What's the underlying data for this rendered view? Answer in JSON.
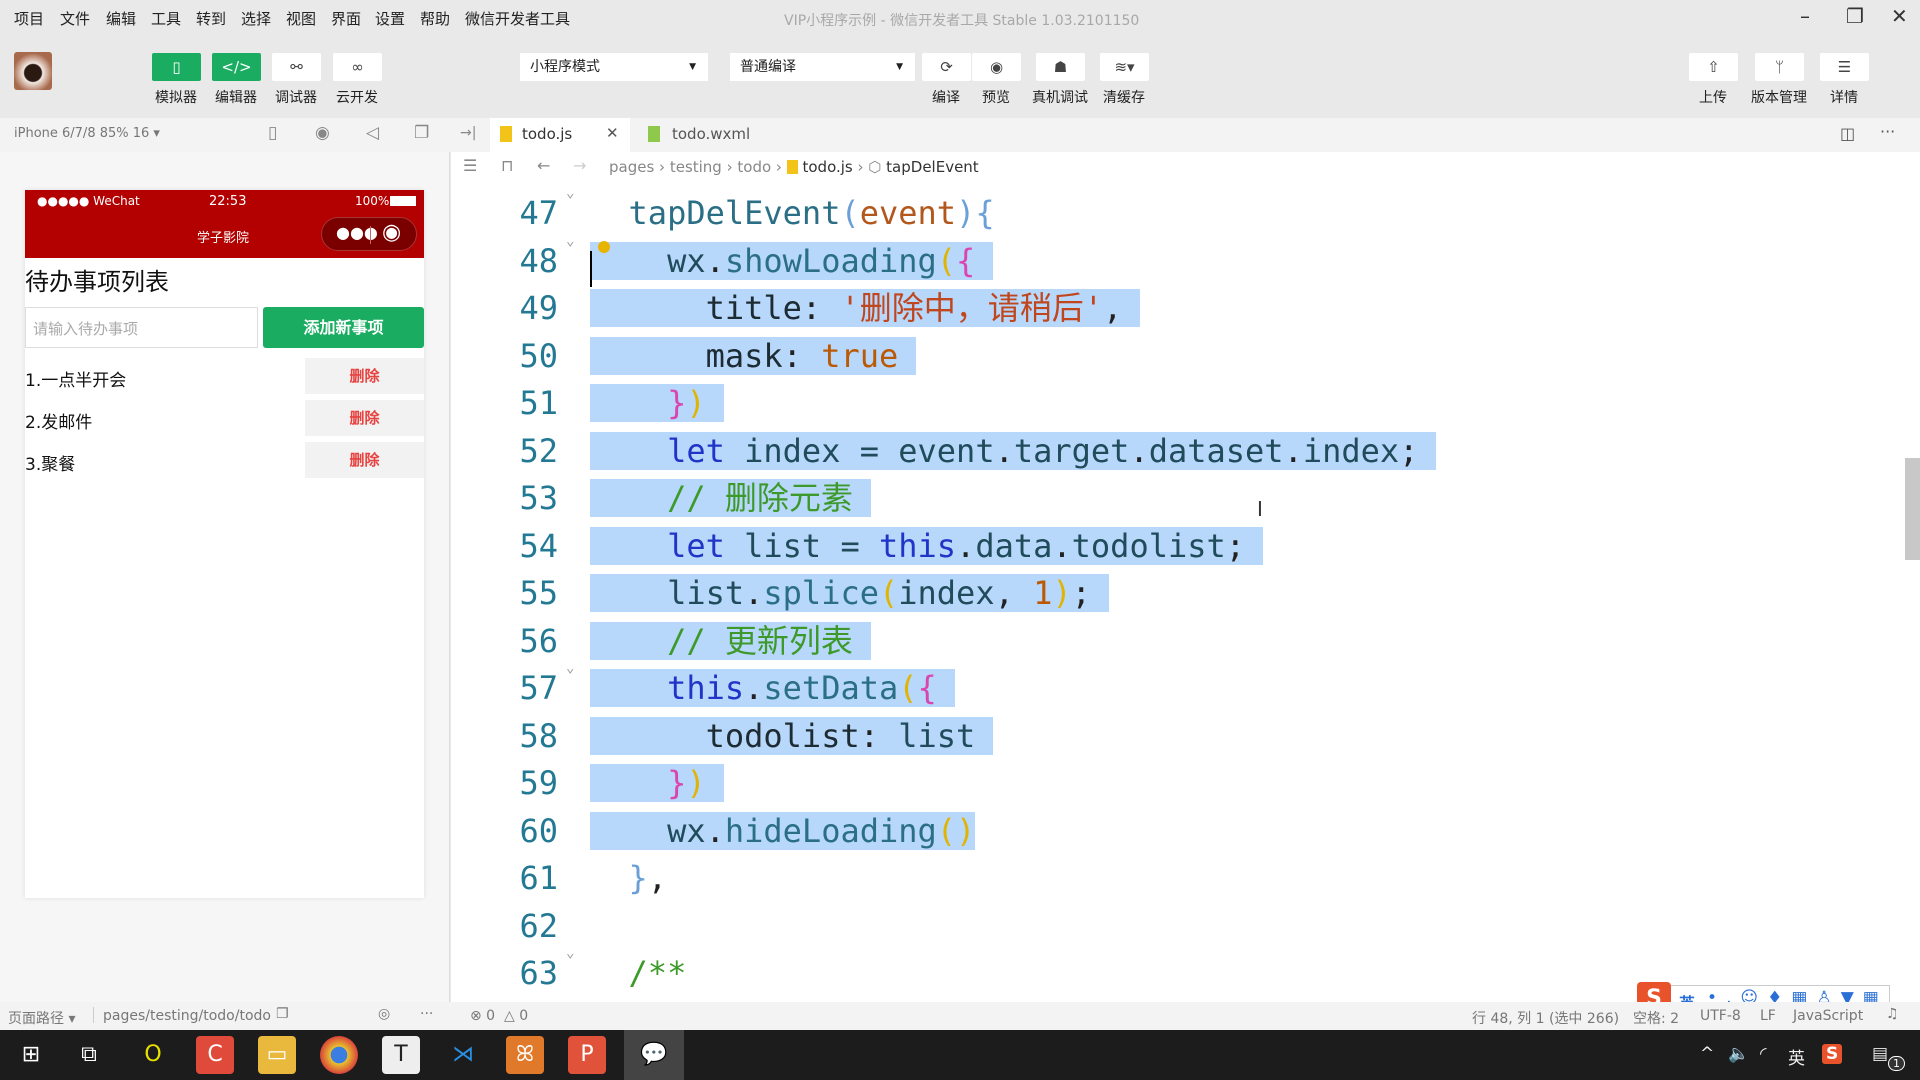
{
  "menubar": {
    "items": [
      "项目",
      "文件",
      "编辑",
      "工具",
      "转到",
      "选择",
      "视图",
      "界面",
      "设置",
      "帮助",
      "微信开发者工具"
    ],
    "title": "VIP小程序示例 - 微信开发者工具 Stable 1.03.2101150"
  },
  "toolbar": {
    "left": [
      {
        "label": "模拟器",
        "icon": "phone-icon",
        "glyph": "▯",
        "active": true
      },
      {
        "label": "编辑器",
        "icon": "code-icon",
        "glyph": "</>",
        "active": true
      },
      {
        "label": "调试器",
        "icon": "debug-sliders-icon",
        "glyph": "⚯",
        "active": false
      },
      {
        "label": "云开发",
        "icon": "cloud-link-icon",
        "glyph": "∞",
        "active": false
      }
    ],
    "mode_select": "小程序模式",
    "compile_select": "普通编译",
    "middle": [
      {
        "label": "编译",
        "icon": "refresh-icon",
        "glyph": "⟳"
      },
      {
        "label": "预览",
        "icon": "eye-icon",
        "glyph": "◉"
      },
      {
        "label": "真机调试",
        "icon": "bug-icon",
        "glyph": "☗"
      },
      {
        "label": "清缓存",
        "icon": "layers-icon",
        "glyph": "≋▾"
      }
    ],
    "right": [
      {
        "label": "上传",
        "icon": "upload-icon",
        "glyph": "⇧"
      },
      {
        "label": "版本管理",
        "icon": "branch-icon",
        "glyph": "ᛘ"
      },
      {
        "label": "详情",
        "icon": "menu-icon",
        "glyph": "☰"
      }
    ]
  },
  "simulator": {
    "device": "iPhone 6/7/8 85% 16 ▾",
    "status": {
      "signal": "●●●●● WeChat",
      "time": "22:53",
      "battery": "100%"
    },
    "nav_title": "学子影院",
    "page_title": "待办事项列表",
    "input_placeholder": "请输入待办事项",
    "add_button": "添加新事项",
    "items": [
      {
        "text": "1.一点半开会",
        "delete": "删除"
      },
      {
        "text": "2.发邮件",
        "delete": "删除"
      },
      {
        "text": "3.聚餐",
        "delete": "删除"
      }
    ]
  },
  "tabs": [
    {
      "label": "todo.js",
      "active": true
    },
    {
      "label": "todo.wxml",
      "active": false
    }
  ],
  "breadcrumb": [
    "pages",
    "testing",
    "todo",
    "todo.js",
    "tapDelEvent"
  ],
  "editor": {
    "lines": [
      {
        "num": "47",
        "fold": true,
        "sel": false,
        "tokens": [
          [
            "  ",
            "p"
          ],
          [
            "tapDelEvent",
            "fn"
          ],
          [
            "(",
            "b3"
          ],
          [
            "event",
            "param"
          ],
          [
            ")",
            "b3"
          ],
          [
            "{",
            "b3"
          ]
        ]
      },
      {
        "num": "48",
        "fold": true,
        "sel": true,
        "tokens": [
          [
            "    ",
            "p"
          ],
          [
            "wx",
            "var"
          ],
          [
            ".",
            "p"
          ],
          [
            "showLoading",
            "fn"
          ],
          [
            "(",
            "b1"
          ],
          [
            "{",
            "b2"
          ]
        ]
      },
      {
        "num": "49",
        "fold": false,
        "sel": true,
        "tokens": [
          [
            "      ",
            "p"
          ],
          [
            "title",
            "prop"
          ],
          [
            ": ",
            "p"
          ],
          [
            "'删除中，请稍后'",
            "str"
          ],
          [
            ",",
            "p"
          ]
        ]
      },
      {
        "num": "50",
        "fold": false,
        "sel": true,
        "tokens": [
          [
            "      ",
            "p"
          ],
          [
            "mask",
            "prop"
          ],
          [
            ": ",
            "p"
          ],
          [
            "true",
            "bool"
          ]
        ]
      },
      {
        "num": "51",
        "fold": false,
        "sel": true,
        "tokens": [
          [
            "    ",
            "p"
          ],
          [
            "}",
            "b2"
          ],
          [
            ")",
            "b1"
          ]
        ]
      },
      {
        "num": "52",
        "fold": false,
        "sel": true,
        "tokens": [
          [
            "    ",
            "p"
          ],
          [
            "let",
            "kw"
          ],
          [
            " index = ",
            "var"
          ],
          [
            "event",
            "var"
          ],
          [
            ".",
            "p"
          ],
          [
            "target",
            "var"
          ],
          [
            ".",
            "p"
          ],
          [
            "dataset",
            "var"
          ],
          [
            ".",
            "p"
          ],
          [
            "index",
            "var"
          ],
          [
            ";",
            "p"
          ]
        ]
      },
      {
        "num": "53",
        "fold": false,
        "sel": true,
        "tokens": [
          [
            "    ",
            "p"
          ],
          [
            "// 删除元素",
            "cm"
          ]
        ]
      },
      {
        "num": "54",
        "fold": false,
        "sel": true,
        "tokens": [
          [
            "    ",
            "p"
          ],
          [
            "let",
            "kw"
          ],
          [
            " list = ",
            "var"
          ],
          [
            "this",
            "kw"
          ],
          [
            ".",
            "p"
          ],
          [
            "data",
            "var"
          ],
          [
            ".",
            "p"
          ],
          [
            "todolist",
            "var"
          ],
          [
            ";",
            "p"
          ]
        ]
      },
      {
        "num": "55",
        "fold": false,
        "sel": true,
        "tokens": [
          [
            "    ",
            "p"
          ],
          [
            "list",
            "var"
          ],
          [
            ".",
            "p"
          ],
          [
            "splice",
            "fn"
          ],
          [
            "(",
            "b1"
          ],
          [
            "index",
            "var"
          ],
          [
            ", ",
            "p"
          ],
          [
            "1",
            "bool"
          ],
          [
            ")",
            "b1"
          ],
          [
            ";",
            "p"
          ]
        ]
      },
      {
        "num": "56",
        "fold": false,
        "sel": true,
        "tokens": [
          [
            "    ",
            "p"
          ],
          [
            "// 更新列表",
            "cm"
          ]
        ]
      },
      {
        "num": "57",
        "fold": true,
        "sel": true,
        "tokens": [
          [
            "    ",
            "p"
          ],
          [
            "this",
            "kw"
          ],
          [
            ".",
            "p"
          ],
          [
            "setData",
            "fn"
          ],
          [
            "(",
            "b1"
          ],
          [
            "{",
            "b2"
          ]
        ]
      },
      {
        "num": "58",
        "fold": false,
        "sel": true,
        "tokens": [
          [
            "      ",
            "p"
          ],
          [
            "todolist",
            "prop"
          ],
          [
            ": ",
            "p"
          ],
          [
            "list",
            "var"
          ]
        ]
      },
      {
        "num": "59",
        "fold": false,
        "sel": true,
        "tokens": [
          [
            "    ",
            "p"
          ],
          [
            "}",
            "b2"
          ],
          [
            ")",
            "b1"
          ]
        ]
      },
      {
        "num": "60",
        "fold": false,
        "sel": true,
        "tokens": [
          [
            "    ",
            "p"
          ],
          [
            "wx",
            "var"
          ],
          [
            ".",
            "p"
          ],
          [
            "hideLoading",
            "fn"
          ],
          [
            "()",
            "b1"
          ]
        ]
      },
      {
        "num": "61",
        "fold": false,
        "sel": false,
        "tokens": [
          [
            "  ",
            "p"
          ],
          [
            "}",
            "b3"
          ],
          [
            ",",
            "p"
          ]
        ]
      },
      {
        "num": "62",
        "fold": false,
        "sel": false,
        "tokens": []
      },
      {
        "num": "63",
        "fold": true,
        "sel": false,
        "tokens": [
          [
            "  ",
            "p"
          ],
          [
            "/**",
            "cm"
          ]
        ]
      }
    ]
  },
  "statusbar": {
    "page_path_label": "页面路径 ▾",
    "page_path": "pages/testing/todo/todo",
    "errors": "⊗ 0",
    "warnings": "△ 0",
    "position": "行 48, 列 1 (选中 266)",
    "spaces": "空格: 2",
    "encoding": "UTF-8",
    "eol": "LF",
    "language": "JavaScript"
  },
  "ime": {
    "lang": "英"
  },
  "taskbar": {
    "tray_lang": "英",
    "notifications": "1"
  },
  "colors": {
    "accent_green": "#1aad62",
    "nav_red": "#b30000",
    "selection": "#b7d7fb",
    "delete_red": "#e64340"
  }
}
